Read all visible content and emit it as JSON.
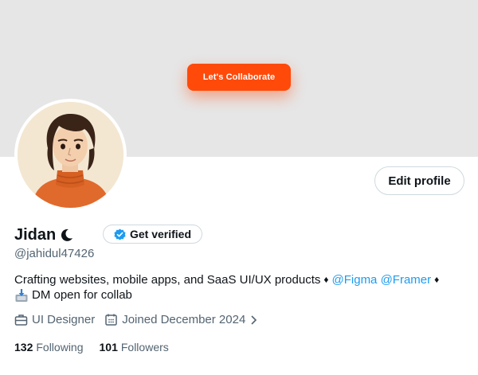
{
  "banner": {
    "collab_button": "Let's Collaborate",
    "accent": "#ff4a0a",
    "background": "#e6e6e6"
  },
  "profile": {
    "name": "Jidan",
    "handle": "@jahidul47426",
    "verify_label": "Get verified",
    "edit_label": "Edit profile",
    "bio": {
      "text": "Crafting websites, mobile apps, and SaaS UI/UX products",
      "mention_1": "@Figma",
      "mention_2": "@Framer",
      "line2": "DM open for collab"
    },
    "job": "UI Designer",
    "joined": "Joined December 2024",
    "following_count": "132",
    "following_label": "Following",
    "followers_count": "101",
    "followers_label": "Followers"
  },
  "colors": {
    "link": "#1d9bf0",
    "secondary_text": "#536471",
    "verified_badge": "#1d9bf0"
  },
  "icons": [
    "moon-icon",
    "verified-badge-icon",
    "diamond-icon",
    "inbox-tray-icon",
    "briefcase-icon",
    "calendar-icon",
    "chevron-right-icon"
  ]
}
